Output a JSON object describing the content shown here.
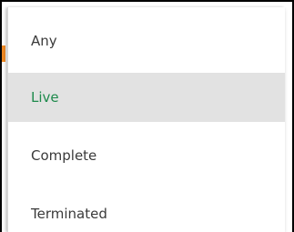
{
  "status_filter": {
    "options": [
      {
        "label": "Any"
      },
      {
        "label": "Live"
      },
      {
        "label": "Complete"
      },
      {
        "label": "Terminated"
      }
    ],
    "selected": "Live"
  },
  "colors": {
    "selected_text": "#1e8a4c",
    "selected_background": "#e2e2e2",
    "text": "#3a3a3a",
    "accent": "#f08a24"
  }
}
